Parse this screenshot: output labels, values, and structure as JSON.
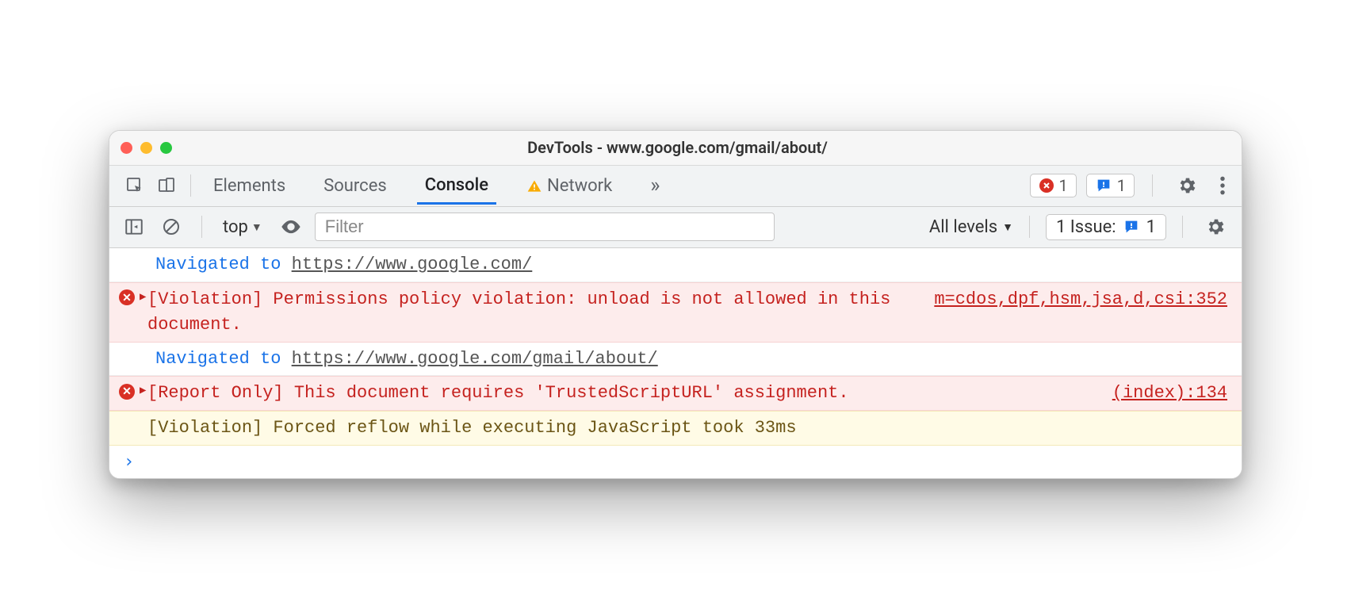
{
  "window": {
    "title": "DevTools - www.google.com/gmail/about/"
  },
  "tabs": {
    "elements": "Elements",
    "sources": "Sources",
    "console": "Console",
    "network": "Network"
  },
  "top_badges": {
    "errors_count": "1",
    "issues_count": "1"
  },
  "toolbar": {
    "context": "top",
    "filter_placeholder": "Filter",
    "levels_label": "All levels",
    "issues_label": "1 Issue:",
    "issues_count": "1"
  },
  "log": {
    "nav1_prefix": "Navigated to ",
    "nav1_url": "https://www.google.com/",
    "err1_msg": "[Violation] Permissions policy violation: unload is not allowed in this document.",
    "err1_src": "m=cdos,dpf,hsm,jsa,d,csi:352",
    "nav2_prefix": "Navigated to ",
    "nav2_url": "https://www.google.com/gmail/about/",
    "err2_msg": "[Report Only] This document requires 'TrustedScriptURL' assignment.",
    "err2_src": "(index):134",
    "warn_msg": "[Violation] Forced reflow while executing JavaScript took 33ms",
    "prompt": "›"
  }
}
